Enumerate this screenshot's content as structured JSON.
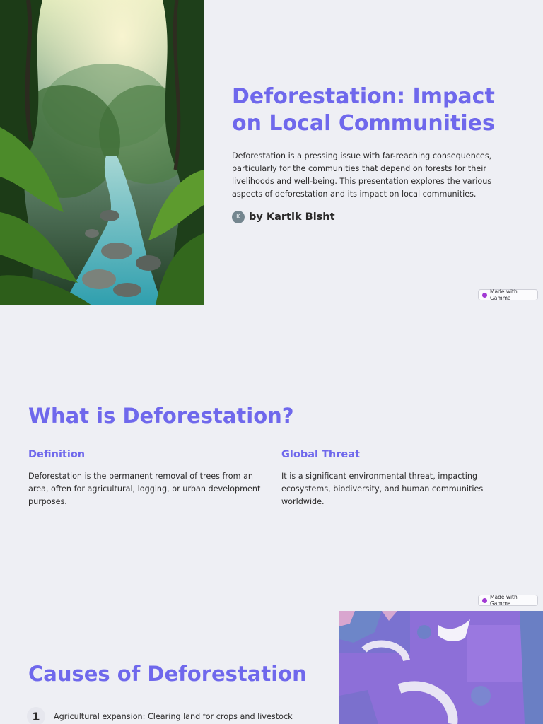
{
  "slide1": {
    "title": "Deforestation: Impact on Local Communities",
    "intro": "Deforestation is a pressing issue with far-reaching consequences, particularly for the communities that depend on forests for their livelihoods and well-being. This presentation explores the various aspects of deforestation and its impact on local communities.",
    "author_initial": "K",
    "author": "by Kartik Bisht",
    "badge": "Made with Gamma"
  },
  "slide2": {
    "title": "What is Deforestation?",
    "columns": [
      {
        "heading": "Definition",
        "text": "Deforestation is the permanent removal of trees from an area, often for agricultural, logging, or urban development purposes."
      },
      {
        "heading": "Global Threat",
        "text": "It is a significant environmental threat, impacting ecosystems, biodiversity, and human communities worldwide."
      }
    ],
    "badge": "Made with Gamma"
  },
  "slide3": {
    "title": "Causes of Deforestation",
    "items": [
      {
        "number": "1",
        "text": "Agricultural expansion: Clearing land for crops and livestock"
      }
    ]
  },
  "colors": {
    "background": "#eeeff4",
    "accent": "#6f68ec",
    "text": "#2b2a2a",
    "gamma_logo": "#a23ad4"
  },
  "icons": {
    "gamma": "gamma-logo-icon",
    "avatar": "author-avatar"
  }
}
